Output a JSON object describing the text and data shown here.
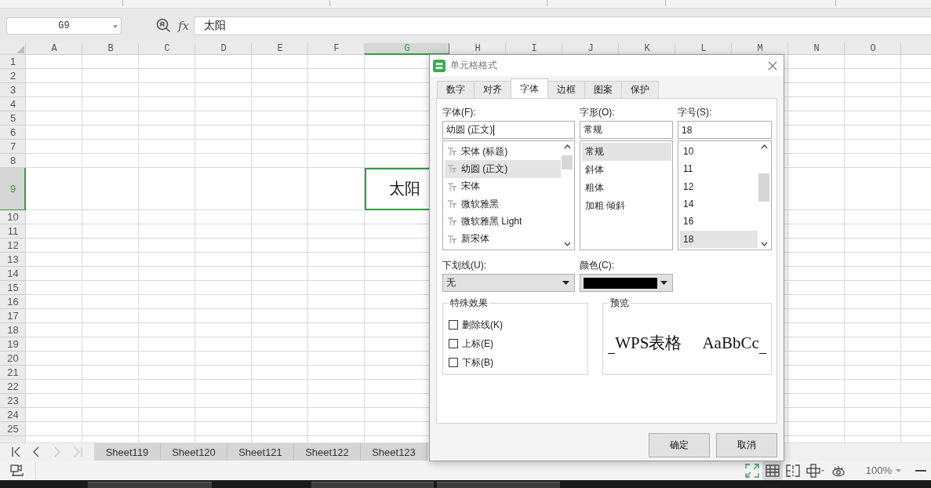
{
  "formula_bar": {
    "name_box": "G9",
    "function_label": "fx",
    "value": "太阳"
  },
  "columns": [
    {
      "label": "A",
      "selected": false
    },
    {
      "label": "B",
      "selected": false
    },
    {
      "label": "C",
      "selected": false
    },
    {
      "label": "D",
      "selected": false
    },
    {
      "label": "E",
      "selected": false
    },
    {
      "label": "F",
      "selected": false
    },
    {
      "label": "G",
      "selected": true
    },
    {
      "label": "H",
      "selected": false
    },
    {
      "label": "I",
      "selected": false
    },
    {
      "label": "J",
      "selected": false
    },
    {
      "label": "K",
      "selected": false
    },
    {
      "label": "L",
      "selected": false
    },
    {
      "label": "M",
      "selected": false
    },
    {
      "label": "N",
      "selected": false
    },
    {
      "label": "O",
      "selected": false
    }
  ],
  "rows": [
    {
      "label": "1",
      "selected": false
    },
    {
      "label": "2",
      "selected": false
    },
    {
      "label": "3",
      "selected": false
    },
    {
      "label": "4",
      "selected": false
    },
    {
      "label": "5",
      "selected": false
    },
    {
      "label": "6",
      "selected": false
    },
    {
      "label": "7",
      "selected": false
    },
    {
      "label": "8",
      "selected": false
    },
    {
      "label": "9",
      "selected": true
    },
    {
      "label": "10",
      "selected": false
    },
    {
      "label": "11",
      "selected": false
    },
    {
      "label": "12",
      "selected": false
    },
    {
      "label": "13",
      "selected": false
    },
    {
      "label": "14",
      "selected": false
    },
    {
      "label": "15",
      "selected": false
    },
    {
      "label": "16",
      "selected": false
    },
    {
      "label": "17",
      "selected": false
    },
    {
      "label": "18",
      "selected": false
    },
    {
      "label": "19",
      "selected": false
    },
    {
      "label": "20",
      "selected": false
    },
    {
      "label": "21",
      "selected": false
    },
    {
      "label": "22",
      "selected": false
    },
    {
      "label": "23",
      "selected": false
    },
    {
      "label": "24",
      "selected": false
    },
    {
      "label": "25",
      "selected": false
    }
  ],
  "active_cell": {
    "text": "太阳"
  },
  "sheet_nav": [
    {
      "kind": "first",
      "disabled": false
    },
    {
      "kind": "prev",
      "disabled": false
    },
    {
      "kind": "next",
      "disabled": true
    },
    {
      "kind": "last",
      "disabled": true
    }
  ],
  "sheet_tabs": [
    {
      "label": "Sheet119",
      "selected": false
    },
    {
      "label": "Sheet120",
      "selected": false
    },
    {
      "label": "Sheet121",
      "selected": false
    },
    {
      "label": "Sheet122",
      "selected": false
    },
    {
      "label": "Sheet123",
      "selected": false
    }
  ],
  "status_bar": {
    "view_buttons": [
      {
        "kind": "fullscreen",
        "selected": false
      },
      {
        "kind": "normal",
        "selected": true
      },
      {
        "kind": "page-break",
        "selected": false
      },
      {
        "kind": "crosshair",
        "selected": false
      },
      {
        "kind": "eye-care",
        "selected": false
      }
    ],
    "zoom": "100%"
  },
  "dialog": {
    "title": "单元格格式",
    "tabs": [
      {
        "label": "数字",
        "selected": false
      },
      {
        "label": "对齐",
        "selected": false
      },
      {
        "label": "字体",
        "selected": true
      },
      {
        "label": "边框",
        "selected": false
      },
      {
        "label": "图案",
        "selected": false
      },
      {
        "label": "保护",
        "selected": false
      }
    ],
    "font": {
      "label": "字体(F):",
      "value": "幼圆 (正文)",
      "items": [
        {
          "label": "宋体 (标题)",
          "selected": false
        },
        {
          "label": "幼圆 (正文)",
          "selected": true
        },
        {
          "label": "宋体",
          "selected": false
        },
        {
          "label": "微软雅黑",
          "selected": false
        },
        {
          "label": "微软雅黑 Light",
          "selected": false
        },
        {
          "label": "新宋体",
          "selected": false
        }
      ]
    },
    "style": {
      "label": "字形(O):",
      "value": "常规",
      "items": [
        {
          "label": "常规",
          "selected": true
        },
        {
          "label": "斜体",
          "selected": false
        },
        {
          "label": "粗体",
          "selected": false
        },
        {
          "label": "加粗 倾斜",
          "selected": false
        }
      ]
    },
    "size": {
      "label": "字号(S):",
      "value": "18",
      "items": [
        {
          "label": "10",
          "selected": false
        },
        {
          "label": "11",
          "selected": false
        },
        {
          "label": "12",
          "selected": false
        },
        {
          "label": "14",
          "selected": false
        },
        {
          "label": "16",
          "selected": false
        },
        {
          "label": "18",
          "selected": true
        }
      ]
    },
    "underline": {
      "label": "下划线(U):",
      "value": "无"
    },
    "color": {
      "label": "颜色(C):",
      "color": "#000000"
    },
    "effects": {
      "legend": "特殊效果",
      "items": [
        {
          "label": "删除线(K)",
          "checked": false
        },
        {
          "label": "上标(E)",
          "checked": false
        },
        {
          "label": "下标(B)",
          "checked": false
        }
      ]
    },
    "preview": {
      "legend": "预览",
      "samples": [
        "WPS表格",
        "AaBbCc"
      ]
    },
    "buttons": [
      "确定",
      "取消"
    ]
  }
}
